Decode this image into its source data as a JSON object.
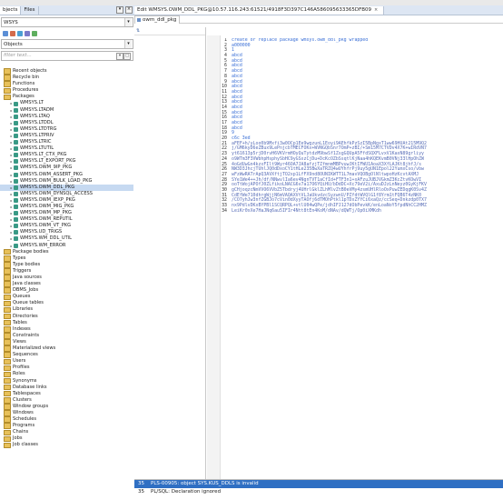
{
  "left_panel": {
    "tabs": [
      "Objects",
      "Files"
    ],
    "tab_display": [
      "bjects",
      "Files"
    ],
    "schema_value": "WSYS",
    "object_type_value": "Objects",
    "filter_placeholder": "filter text...",
    "tree": [
      {
        "label": "Recent objects",
        "kind": "folder",
        "indent": 0
      },
      {
        "label": "Recycle bin",
        "kind": "folder",
        "indent": 0
      },
      {
        "label": "Functions",
        "kind": "folder",
        "indent": 0
      },
      {
        "label": "Procedures",
        "kind": "folder",
        "indent": 0
      },
      {
        "label": "Packages",
        "kind": "folder",
        "indent": 0,
        "expanded": true
      },
      {
        "label": "WMSYS.LT",
        "kind": "pkg",
        "indent": 1
      },
      {
        "label": "WMSYS.LTADM",
        "kind": "pkg",
        "indent": 1
      },
      {
        "label": "WMSYS.LTAQ",
        "kind": "pkg",
        "indent": 1
      },
      {
        "label": "WMSYS.LTDDL",
        "kind": "pkg",
        "indent": 1
      },
      {
        "label": "WMSYS.LTDTRG",
        "kind": "pkg",
        "indent": 1
      },
      {
        "label": "WMSYS.LTPRIV",
        "kind": "pkg",
        "indent": 1
      },
      {
        "label": "WMSYS.LTRIC",
        "kind": "pkg",
        "indent": 1
      },
      {
        "label": "WMSYS.LTUTIL",
        "kind": "pkg",
        "indent": 1
      },
      {
        "label": "WMSYS.LT_CTX_PKG",
        "kind": "pkg",
        "indent": 1
      },
      {
        "label": "WMSYS.LT_EXPORT_PKG",
        "kind": "pkg",
        "indent": 1
      },
      {
        "label": "WMSYS.OWM_9IP_PKG",
        "kind": "pkg",
        "indent": 1
      },
      {
        "label": "WMSYS.OWM_ASSERT_PKG",
        "kind": "pkg",
        "indent": 1
      },
      {
        "label": "WMSYS.OWM_BULK_LOAD_PKG",
        "kind": "pkg",
        "indent": 1
      },
      {
        "label": "WMSYS.OWM_DDL_PKG",
        "kind": "pkg",
        "indent": 1,
        "selected": true
      },
      {
        "label": "WMSYS.OWM_DYNSQL_ACCESS",
        "kind": "pkg",
        "indent": 1
      },
      {
        "label": "WMSYS.OWM_IEXP_PKG",
        "kind": "pkg",
        "indent": 1
      },
      {
        "label": "WMSYS.OWM_MIG_PKG",
        "kind": "pkg",
        "indent": 1
      },
      {
        "label": "WMSYS.OWM_MP_PKG",
        "kind": "pkg",
        "indent": 1
      },
      {
        "label": "WMSYS.OWM_REPUTIL",
        "kind": "pkg",
        "indent": 1
      },
      {
        "label": "WMSYS.OWM_VT_PKG",
        "kind": "pkg",
        "indent": 1
      },
      {
        "label": "WMSYS.UD_TRIGS",
        "kind": "pkg",
        "indent": 1
      },
      {
        "label": "WMSYS.WM_DDL_UTIL",
        "kind": "pkg",
        "indent": 1
      },
      {
        "label": "WMSYS.WM_ERROR",
        "kind": "pkg",
        "indent": 1
      },
      {
        "label": "Package bodies",
        "kind": "folder",
        "indent": 0
      },
      {
        "label": "Types",
        "kind": "folder",
        "indent": 0
      },
      {
        "label": "Type bodies",
        "kind": "folder",
        "indent": 0
      },
      {
        "label": "Triggers",
        "kind": "folder",
        "indent": 0
      },
      {
        "label": "Java sources",
        "kind": "folder",
        "indent": 0
      },
      {
        "label": "Java classes",
        "kind": "folder",
        "indent": 0
      },
      {
        "label": "DBMS_Jobs",
        "kind": "folder",
        "indent": 0
      },
      {
        "label": "Queues",
        "kind": "folder",
        "indent": 0
      },
      {
        "label": "Queue tables",
        "kind": "folder",
        "indent": 0
      },
      {
        "label": "Libraries",
        "kind": "folder",
        "indent": 0
      },
      {
        "label": "Directories",
        "kind": "folder",
        "indent": 0
      },
      {
        "label": "Tables",
        "kind": "folder",
        "indent": 0
      },
      {
        "label": "Indexes",
        "kind": "folder",
        "indent": 0
      },
      {
        "label": "Constraints",
        "kind": "folder",
        "indent": 0
      },
      {
        "label": "Views",
        "kind": "folder",
        "indent": 0
      },
      {
        "label": "Materialized views",
        "kind": "folder",
        "indent": 0
      },
      {
        "label": "Sequences",
        "kind": "folder",
        "indent": 0
      },
      {
        "label": "Users",
        "kind": "folder",
        "indent": 0
      },
      {
        "label": "Profiles",
        "kind": "folder",
        "indent": 0
      },
      {
        "label": "Roles",
        "kind": "folder",
        "indent": 0
      },
      {
        "label": "Synonyms",
        "kind": "folder",
        "indent": 0
      },
      {
        "label": "Database links",
        "kind": "folder",
        "indent": 0
      },
      {
        "label": "Tablespaces",
        "kind": "folder",
        "indent": 0
      },
      {
        "label": "Clusters",
        "kind": "folder",
        "indent": 0
      },
      {
        "label": "Window groups",
        "kind": "folder",
        "indent": 0
      },
      {
        "label": "Windows",
        "kind": "folder",
        "indent": 0
      },
      {
        "label": "Schedules",
        "kind": "folder",
        "indent": 0
      },
      {
        "label": "Programs",
        "kind": "folder",
        "indent": 0
      },
      {
        "label": "Chains",
        "kind": "folder",
        "indent": 0
      },
      {
        "label": "Jobs",
        "kind": "folder",
        "indent": 0
      },
      {
        "label": "Job classes",
        "kind": "folder",
        "indent": 0
      }
    ]
  },
  "editor": {
    "doc_tab_title": "Edit WMSYS.OWM_DDL_PKG@10.57.116.243:61521/4918F3D397C146A586095633365DFB09",
    "sub_tab": "owm_ddl_pkg",
    "object_pane_header": "",
    "lines": [
      {
        "n": "1",
        "text": "create or replace package wmsys.owm_ddl_pkg wrapped"
      },
      {
        "n": "2",
        "text": "a000000"
      },
      {
        "n": "3",
        "text": "1"
      },
      {
        "n": "4",
        "text": "abcd"
      },
      {
        "n": "5",
        "text": "abcd"
      },
      {
        "n": "6",
        "text": "abcd"
      },
      {
        "n": "7",
        "text": "abcd"
      },
      {
        "n": "8",
        "text": "abcd"
      },
      {
        "n": "9",
        "text": "abcd"
      },
      {
        "n": "10",
        "text": "abcd"
      },
      {
        "n": "11",
        "text": "abcd"
      },
      {
        "n": "12",
        "text": "abcd"
      },
      {
        "n": "13",
        "text": "abcd"
      },
      {
        "n": "14",
        "text": "abcd"
      },
      {
        "n": "15",
        "text": "abcd"
      },
      {
        "n": "16",
        "text": "abcd"
      },
      {
        "n": "17",
        "text": "abcd"
      },
      {
        "n": "18",
        "text": "abcd"
      },
      {
        "n": "19",
        "text": "9"
      },
      {
        "n": "20",
        "text": "c6c 3ed"
      },
      {
        "n": "21",
        "text": "aFEF+h/yLoo0b9Mxfi3w0OCp1Ee9wgzunL1Eoyi9AEhfkPzSzI5BpNgxT1ww69HUAt215M9Q2"
      },
      {
        "n": "22",
        "text": "j/GM6kyD6eZBux9LePnjcbTMECFOKx+WVNGQbSnr7OmP+zBI/+Sm15M7CTVDv4X7K+wIRdVN7"
      },
      {
        "n": "23",
        "text": "yt61613p5rjD0rvH6VKVrmHOyQuTytdzM9bwSf1ZsgGQUpA5FfdSQXFLvxV1KaxN89grliyy"
      },
      {
        "n": "24",
        "text": "o9WTm3F3VWbhpHsphySbHC9yGSxzCjDu+DcKcOZbSsqtlKjNaa4hKQEKvmB0VNj33lHpOhZW"
      },
      {
        "n": "25",
        "text": "4oGdUwGn4kzxFIlt9Wyr46OA7JA8afzjTZfmnmMBPvuwJKtIFWU1AoaX3XfLAJKt8jhfJ/s"
      },
      {
        "n": "26",
        "text": "NW3D3JhcjTUhlJQ0dDxoCY1tHLe235BwXaTRZQ4wUYhfrPj9uy5gUN1Epol22YumxCso/vbw"
      },
      {
        "n": "27",
        "text": "wFzWwRATrApQ3AVXftjTO2xp1LfFX9nd8OUNIKWTT1L7mavVQOBgOlNltwpoHzKcvtAXMJ"
      },
      {
        "n": "28",
        "text": "SYe1We4++Jh/df/NNwvlIa6ev4NgnTVT1aCfId+FTF3n1+xAFzuJUBJVGkmZ3KcZtvKOwVI"
      },
      {
        "n": "29",
        "text": "ooTtWojAPOfJ0ZLfikoLNACG6v7a17O6YQiHU/bDdDC+Xc79eV2i/AxuDJzLnNeyz0GyKjFKV"
      },
      {
        "n": "30",
        "text": "gCHjoqzcNmVVO6VVbZ5Tbdryj4UHrlGklZLhMlvZtB0eVMy4zsmUHlRloOxPuwZEDqgK0Sv4Z"
      },
      {
        "n": "31",
        "text": "CdEfWe710dhrgWjjN6mVAQAXVtVLJaUkvdzcSyzwnU/PZfdtWVQlG1f8Yrm1tFQB6T4zNK0"
      },
      {
        "n": "32",
        "text": "/CO7yhJw3nfZGBJo7cVin0dXyyTAOfj6dTMOhPtkl1pTDxZYYCi6xaQz/ccSeq+Dnkzdp0TX7"
      },
      {
        "n": "33",
        "text": "nx9PdlvDKxBYPBl1SCQRPQL+vtlU04wQPe/jdhIFJ127dObPevkK/enLoaNoY5fpdNhCC2HMZ"
      },
      {
        "n": "34",
        "text": "LeiKr0xXe7HaJNq6au5IFIr4Ntt8tEn4KoM/dNAv/dQWTj/Op0iXMKdh"
      }
    ]
  },
  "messages": [
    {
      "n": "35",
      "text": "PLS-00905: object SYS.KUS_DDLS is invalid",
      "selected": true
    },
    {
      "n": "35",
      "text": "PL/SQL: Declaration ignored",
      "selected": false
    }
  ],
  "colors": {
    "code": "#3a6fd6",
    "selection": "#c6d9f1",
    "message_selection": "#2f6fc3"
  }
}
